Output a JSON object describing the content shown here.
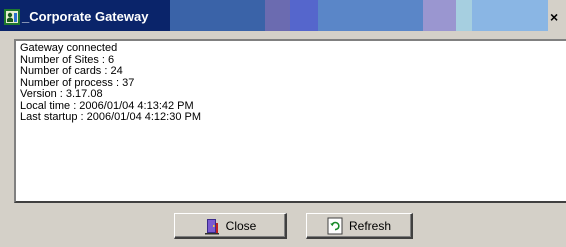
{
  "window": {
    "title": "_Corporate Gateway",
    "close_glyph": "×",
    "icon": "gateway-app-icon"
  },
  "log": {
    "lines": [
      "Gateway connected",
      "Number of Sites : 6",
      "Number of cards : 24",
      "Number of process : 37",
      "Version : 3.17.08",
      "Local time : 2006/01/04 4:13:42 PM",
      "Last startup : 2006/01/04 4:12:30 PM"
    ]
  },
  "buttons": {
    "close_label": "Close",
    "close_icon": "door-exit-icon",
    "refresh_label": "Refresh",
    "refresh_icon": "refresh-icon"
  },
  "colors": {
    "titlebar": "#0a246a",
    "face": "#d4d0c8",
    "log_background": "#ffffff"
  }
}
